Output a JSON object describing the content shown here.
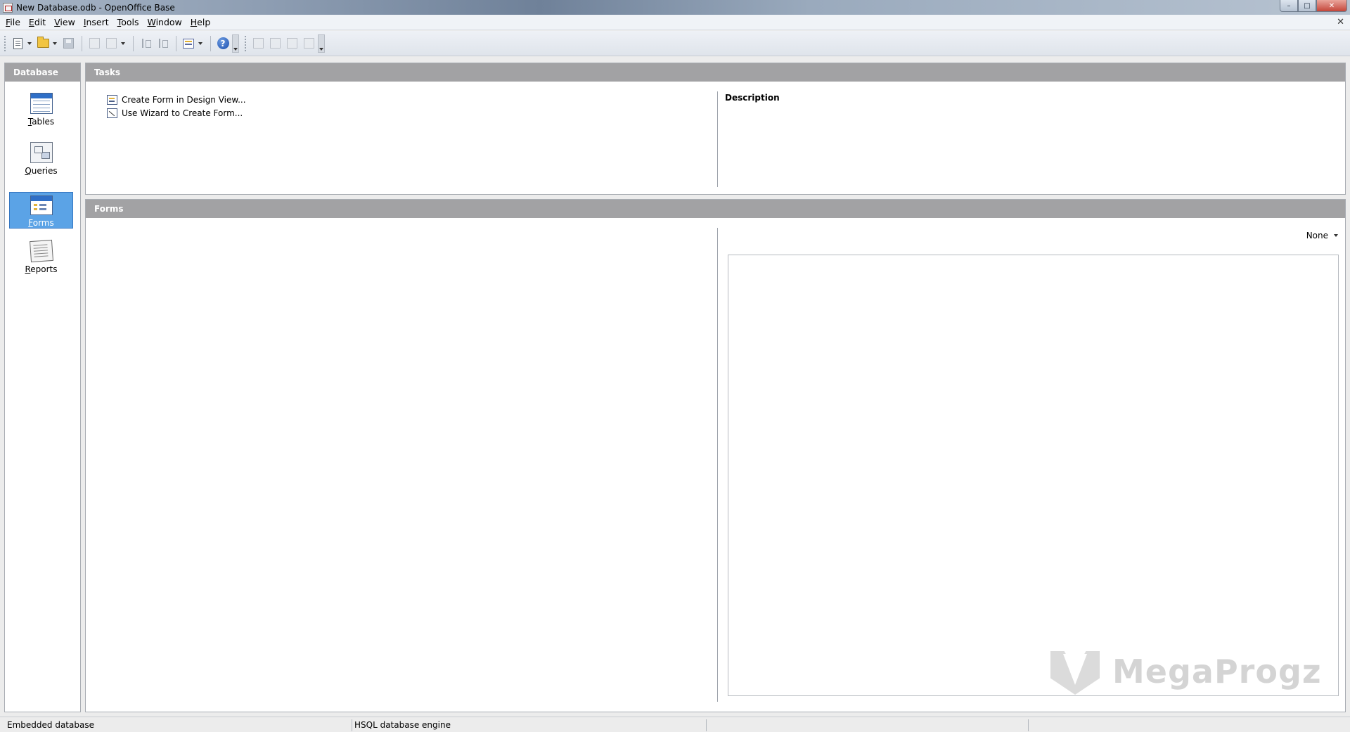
{
  "window": {
    "title": "New Database.odb - OpenOffice Base",
    "controls": {
      "minimize": "–",
      "maximize": "□",
      "close": "✕"
    },
    "doc_close": "✕"
  },
  "menu": [
    {
      "u": "F",
      "rest": "ile"
    },
    {
      "u": "E",
      "rest": "dit"
    },
    {
      "u": "V",
      "rest": "iew"
    },
    {
      "u": "I",
      "rest": "nsert"
    },
    {
      "u": "T",
      "rest": "ools"
    },
    {
      "u": "W",
      "rest": "indow"
    },
    {
      "u": "H",
      "rest": "elp"
    }
  ],
  "toolbar": {
    "help_glyph": "?",
    "icons": [
      "new-document-icon",
      "open-folder-icon",
      "save-icon",
      "copy-icon",
      "paste-icon",
      "sort-ascending-icon",
      "sort-descending-icon",
      "form-icon",
      "help-icon",
      "open-object-icon",
      "edit-object-icon",
      "delete-object-icon",
      "rename-object-icon"
    ]
  },
  "database_panel": {
    "header": "Database",
    "items": [
      {
        "u": "T",
        "rest": "ables",
        "icon": "tables-icon",
        "selected": false
      },
      {
        "u": "Q",
        "rest": "ueries",
        "icon": "queries-icon",
        "selected": false
      },
      {
        "u": "F",
        "rest": "orms",
        "icon": "forms-icon",
        "selected": true
      },
      {
        "u": "R",
        "rest": "eports",
        "icon": "reports-icon",
        "selected": false
      }
    ]
  },
  "tasks_panel": {
    "header": "Tasks",
    "items": [
      {
        "label": "Create Form in Design View...",
        "icon": "design-view-icon"
      },
      {
        "label": "Use Wizard to Create Form...",
        "icon": "wizard-icon"
      }
    ],
    "description_title": "Description"
  },
  "forms_panel": {
    "header": "Forms",
    "preview_mode": "None"
  },
  "watermark": {
    "text": "MegaProgz"
  },
  "status": {
    "field1": "Embedded database",
    "field2": "HSQL database engine"
  }
}
